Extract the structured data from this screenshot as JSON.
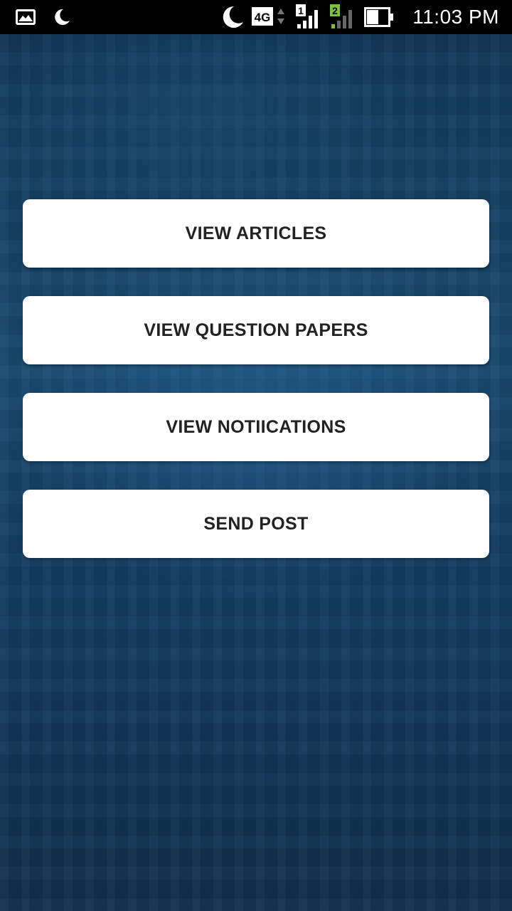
{
  "status_bar": {
    "time": "11:03 PM",
    "network_type": "4G",
    "sim1_label": "1",
    "sim2_label": "2",
    "left_icons": [
      "image-notification-icon",
      "moon-icon"
    ],
    "right_icons": [
      "moon-icon",
      "4g-icon",
      "sim1-signal-icon",
      "sim2-signal-icon",
      "battery-icon"
    ],
    "colors": {
      "background": "#000000",
      "text": "#ffffff",
      "sim2_badge": "#7ac143"
    }
  },
  "menu": {
    "buttons": [
      {
        "label": "VIEW ARTICLES"
      },
      {
        "label": "VIEW QUESTION PAPERS"
      },
      {
        "label": "VIEW NOTIICATIONS"
      },
      {
        "label": "SEND POST"
      }
    ]
  },
  "theme": {
    "background": "#133a5c",
    "button_background": "#ffffff",
    "button_text": "#222222"
  }
}
